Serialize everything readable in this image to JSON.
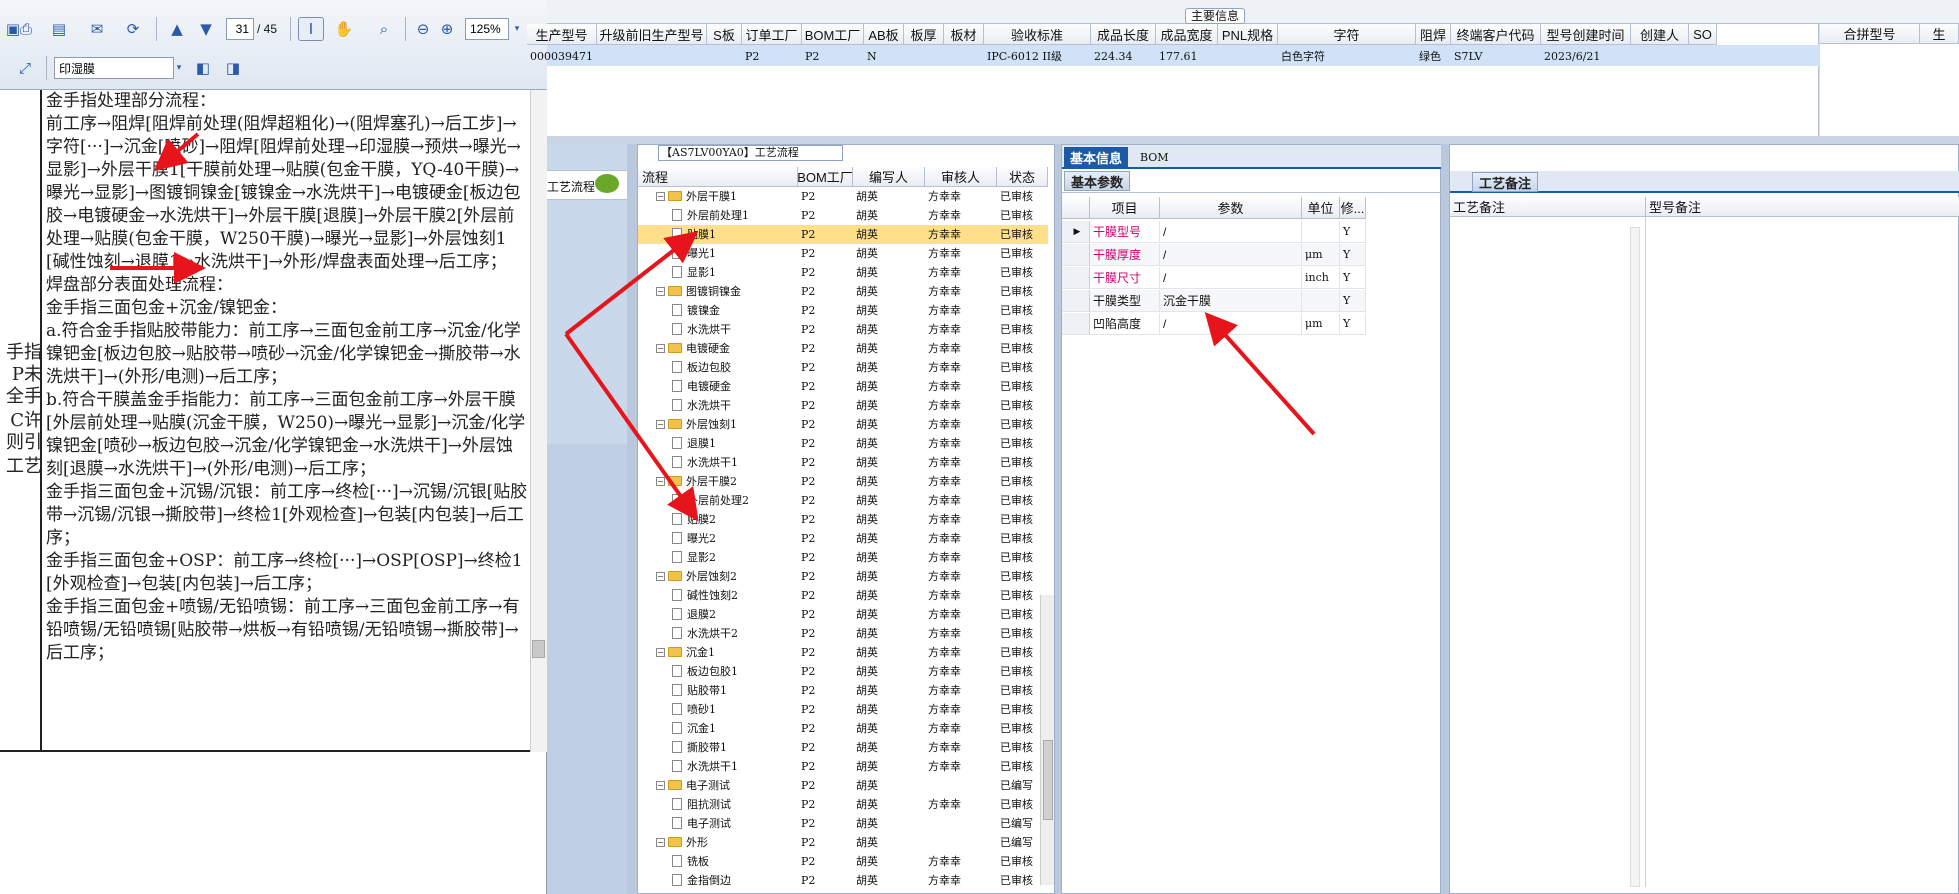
{
  "pdf": {
    "page_current": "31",
    "page_total": "/ 45",
    "zoom": "125%",
    "stamp_select": "印湿膜",
    "left_col_fragments": [
      "手指",
      "P未",
      "全手",
      "C许",
      "则引",
      "工艺"
    ],
    "paragraphs": [
      "金手指处理部分流程：",
      "前工序→阻焊[阻焊前处理(阻焊超粗化)→(阻焊塞孔)→后工步]→字符[···]→沉金[喷砂]→阻焊[阻焊前处理→印湿膜→预烘→曝光→显影]→外层干膜1[干膜前处理→贴膜(包金干膜，YQ-40干膜)→曝光→显影]→图镀铜镍金[镀镍金→水洗烘干]→电镀硬金[板边包胶→电镀硬金→水洗烘干]→外层干膜[退膜]→外层干膜2[外层前处理→贴膜(包金干膜，W250干膜)→曝光→显影]→外层蚀刻1[碱性蚀刻→退膜1→水洗烘干]→外形/焊盘表面处理→后工序；",
      "焊盘部分表面处理流程：",
      "金手指三面包金+沉金/镍钯金：",
      "a.符合金手指贴胶带能力：前工序→三面包金前工序→沉金/化学镍钯金[板边包胶→贴胶带→喷砂→沉金/化学镍钯金→撕胶带→水洗烘干]→(外形/电测)→后工序；",
      "b.符合干膜盖金手指能力：前工序→三面包金前工序→外层干膜[外层前处理→贴膜(沉金干膜，W250)→曝光→显影]→沉金/化学镍钯金[喷砂→板边包胶→沉金/化学镍钯金→水洗烘干]→外层蚀刻[退膜→水洗烘干]→(外形/电测)→后工序；",
      "金手指三面包金+沉锡/沉银：前工序→终检[···]→沉锡/沉银[贴胶带→沉锡/沉银→撕胶带]→终检1[外观检查]→包装[内包装]→后工序；",
      "金手指三面包金+OSP：前工序→终检[···]→OSP[OSP]→终检1[外观检查]→包装[内包装]→后工序；",
      "金手指三面包金+喷锡/无铅喷锡：前工序→三面包金前工序→有铅喷锡/无铅喷锡[贴胶带→烘板→有铅喷锡/无铅喷锡→撕胶带]→后工序；"
    ]
  },
  "main_info": {
    "title": "主要信息",
    "columns": [
      "生产型号",
      "升级前旧生产型号",
      "S板",
      "订单工厂",
      "BOM工厂",
      "AB板",
      "板厚",
      "板材",
      "验收标准",
      "成品长度",
      "成品宽度",
      "PNL规格",
      "字符",
      "阻焊",
      "终端客户代码",
      "型号创建时间",
      "创建人",
      "SO"
    ],
    "row": [
      "000039471",
      "",
      "",
      "P2",
      "P2",
      "N",
      "",
      "",
      "IPC-6012 II级",
      "224.34",
      "177.61",
      "",
      "白色字符",
      "绿色",
      "S7LV",
      "2023/6/21",
      "",
      ""
    ],
    "side_columns": [
      "合拼型号",
      "生"
    ]
  },
  "left_nav": {
    "item": "工艺流程"
  },
  "process": {
    "title": "【AS7LV00YA0】工艺流程",
    "columns": [
      "流程",
      "BOM工厂",
      "编写人",
      "审核人",
      "状态"
    ],
    "rows": [
      {
        "level": 0,
        "name": "外层干膜1",
        "bom": "P2",
        "writer": "胡英",
        "reviewer": "方幸幸",
        "status": "已审核"
      },
      {
        "level": 1,
        "name": "外层前处理1",
        "bom": "P2",
        "writer": "胡英",
        "reviewer": "方幸幸",
        "status": "已审核"
      },
      {
        "level": 1,
        "name": "贴膜1",
        "bom": "P2",
        "writer": "胡英",
        "reviewer": "方幸幸",
        "status": "已审核",
        "selected": true
      },
      {
        "level": 1,
        "name": "曝光1",
        "bom": "P2",
        "writer": "胡英",
        "reviewer": "方幸幸",
        "status": "已审核"
      },
      {
        "level": 1,
        "name": "显影1",
        "bom": "P2",
        "writer": "胡英",
        "reviewer": "方幸幸",
        "status": "已审核"
      },
      {
        "level": 0,
        "name": "图镀铜镍金",
        "bom": "P2",
        "writer": "胡英",
        "reviewer": "方幸幸",
        "status": "已审核"
      },
      {
        "level": 1,
        "name": "镀镍金",
        "bom": "P2",
        "writer": "胡英",
        "reviewer": "方幸幸",
        "status": "已审核"
      },
      {
        "level": 1,
        "name": "水洗烘干",
        "bom": "P2",
        "writer": "胡英",
        "reviewer": "方幸幸",
        "status": "已审核"
      },
      {
        "level": 0,
        "name": "电镀硬金",
        "bom": "P2",
        "writer": "胡英",
        "reviewer": "方幸幸",
        "status": "已审核"
      },
      {
        "level": 1,
        "name": "板边包胶",
        "bom": "P2",
        "writer": "胡英",
        "reviewer": "方幸幸",
        "status": "已审核"
      },
      {
        "level": 1,
        "name": "电镀硬金",
        "bom": "P2",
        "writer": "胡英",
        "reviewer": "方幸幸",
        "status": "已审核"
      },
      {
        "level": 1,
        "name": "水洗烘干",
        "bom": "P2",
        "writer": "胡英",
        "reviewer": "方幸幸",
        "status": "已审核"
      },
      {
        "level": 0,
        "name": "外层蚀刻1",
        "bom": "P2",
        "writer": "胡英",
        "reviewer": "方幸幸",
        "status": "已审核"
      },
      {
        "level": 1,
        "name": "退膜1",
        "bom": "P2",
        "writer": "胡英",
        "reviewer": "方幸幸",
        "status": "已审核"
      },
      {
        "level": 1,
        "name": "水洗烘干1",
        "bom": "P2",
        "writer": "胡英",
        "reviewer": "方幸幸",
        "status": "已审核"
      },
      {
        "level": 0,
        "name": "外层干膜2",
        "bom": "P2",
        "writer": "胡英",
        "reviewer": "方幸幸",
        "status": "已审核"
      },
      {
        "level": 1,
        "name": "外层前处理2",
        "bom": "P2",
        "writer": "胡英",
        "reviewer": "方幸幸",
        "status": "已审核"
      },
      {
        "level": 1,
        "name": "贴膜2",
        "bom": "P2",
        "writer": "胡英",
        "reviewer": "方幸幸",
        "status": "已审核"
      },
      {
        "level": 1,
        "name": "曝光2",
        "bom": "P2",
        "writer": "胡英",
        "reviewer": "方幸幸",
        "status": "已审核"
      },
      {
        "level": 1,
        "name": "显影2",
        "bom": "P2",
        "writer": "胡英",
        "reviewer": "方幸幸",
        "status": "已审核"
      },
      {
        "level": 0,
        "name": "外层蚀刻2",
        "bom": "P2",
        "writer": "胡英",
        "reviewer": "方幸幸",
        "status": "已审核"
      },
      {
        "level": 1,
        "name": "碱性蚀刻2",
        "bom": "P2",
        "writer": "胡英",
        "reviewer": "方幸幸",
        "status": "已审核"
      },
      {
        "level": 1,
        "name": "退膜2",
        "bom": "P2",
        "writer": "胡英",
        "reviewer": "方幸幸",
        "status": "已审核"
      },
      {
        "level": 1,
        "name": "水洗烘干2",
        "bom": "P2",
        "writer": "胡英",
        "reviewer": "方幸幸",
        "status": "已审核"
      },
      {
        "level": 0,
        "name": "沉金1",
        "bom": "P2",
        "writer": "胡英",
        "reviewer": "方幸幸",
        "status": "已审核"
      },
      {
        "level": 1,
        "name": "板边包胶1",
        "bom": "P2",
        "writer": "胡英",
        "reviewer": "方幸幸",
        "status": "已审核"
      },
      {
        "level": 1,
        "name": "贴胶带1",
        "bom": "P2",
        "writer": "胡英",
        "reviewer": "方幸幸",
        "status": "已审核"
      },
      {
        "level": 1,
        "name": "喷砂1",
        "bom": "P2",
        "writer": "胡英",
        "reviewer": "方幸幸",
        "status": "已审核"
      },
      {
        "level": 1,
        "name": "沉金1",
        "bom": "P2",
        "writer": "胡英",
        "reviewer": "方幸幸",
        "status": "已审核"
      },
      {
        "level": 1,
        "name": "撕胶带1",
        "bom": "P2",
        "writer": "胡英",
        "reviewer": "方幸幸",
        "status": "已审核"
      },
      {
        "level": 1,
        "name": "水洗烘干1",
        "bom": "P2",
        "writer": "胡英",
        "reviewer": "方幸幸",
        "status": "已审核"
      },
      {
        "level": 0,
        "name": "电子测试",
        "bom": "P2",
        "writer": "胡英",
        "reviewer": "",
        "status": "已编写"
      },
      {
        "level": 1,
        "name": "阻抗测试",
        "bom": "P2",
        "writer": "胡英",
        "reviewer": "方幸幸",
        "status": "已审核"
      },
      {
        "level": 1,
        "name": "电子测试",
        "bom": "P2",
        "writer": "胡英",
        "reviewer": "",
        "status": "已编写"
      },
      {
        "level": 0,
        "name": "外形",
        "bom": "P2",
        "writer": "胡英",
        "reviewer": "",
        "status": "已编写"
      },
      {
        "level": 1,
        "name": "铣板",
        "bom": "P2",
        "writer": "胡英",
        "reviewer": "方幸幸",
        "status": "已审核"
      },
      {
        "level": 1,
        "name": "金指倒边",
        "bom": "P2",
        "writer": "胡英",
        "reviewer": "方幸幸",
        "status": "已审核"
      }
    ]
  },
  "basic": {
    "tab_basic": "基本信息",
    "tab_bom": "BOM",
    "sub_tab": "基本参数",
    "columns": [
      "项目",
      "参数",
      "单位",
      "修..."
    ],
    "rows": [
      {
        "item": "干膜型号",
        "value": "/",
        "unit": "",
        "mod": "Y",
        "pink": true
      },
      {
        "item": "干膜厚度",
        "value": "/",
        "unit": "μm",
        "mod": "Y",
        "pink": true
      },
      {
        "item": "干膜尺寸",
        "value": "/",
        "unit": "inch",
        "mod": "Y",
        "pink": true
      },
      {
        "item": "干膜类型",
        "value": "沉金干膜",
        "unit": "",
        "mod": "Y",
        "pink": false
      },
      {
        "item": "凹陷高度",
        "value": "/",
        "unit": "μm",
        "mod": "Y",
        "pink": false
      }
    ]
  },
  "remarks": {
    "tab": "工艺备注",
    "col1": "工艺备注",
    "col2": "型号备注"
  },
  "colors": {
    "panel_blue": "#1c5aa5",
    "selected_row": "#ffe08a",
    "highlight_row": "#cfe2f7",
    "pink_text": "#d1006f",
    "annotation_red": "#e8141c"
  }
}
